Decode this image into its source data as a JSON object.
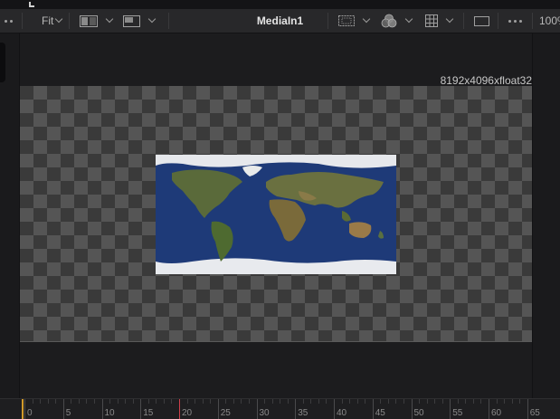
{
  "toolbar": {
    "fit_label": "Fit",
    "viewer_title": "MediaIn1",
    "zoom_label": "100%"
  },
  "viewer": {
    "resolution_label": "8192x4096xfloat32"
  },
  "timeline": {
    "ticks": [
      "0",
      "5",
      "10",
      "15",
      "20",
      "25",
      "30",
      "35",
      "40",
      "45",
      "50",
      "55",
      "60",
      "65"
    ],
    "playhead_frame": 20,
    "in_frame": 0
  },
  "colors": {
    "accent_playhead": "#d0404a",
    "in_marker": "#d09a2a",
    "ocean": "#1e3a78"
  },
  "icons": {
    "more": "ellipsis-icon",
    "layout_a": "split-view-icon",
    "layout_b": "view-layout-icon",
    "roi": "roi-icon",
    "color_channel": "color-channel-icon",
    "grid": "grid-icon",
    "frame_guide": "frame-guide-icon"
  }
}
